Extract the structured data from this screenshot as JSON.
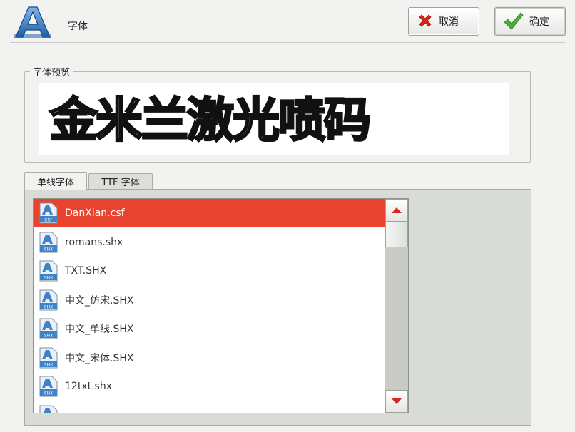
{
  "header": {
    "title": "字体",
    "cancel_label": "取消",
    "ok_label": "确定",
    "logo_icon": "font-letter-a-icon"
  },
  "preview": {
    "legend": "字体预览",
    "sample_text": "金米兰激光喷码"
  },
  "tabs": [
    {
      "label": "单线字体",
      "active": true
    },
    {
      "label": "TTF 字体",
      "active": false
    }
  ],
  "font_list": {
    "items": [
      {
        "name": "DanXian.csf",
        "badge": "CSF",
        "selected": true
      },
      {
        "name": "romans.shx",
        "badge": "SHX",
        "selected": false
      },
      {
        "name": "TXT.SHX",
        "badge": "SHX",
        "selected": false
      },
      {
        "name": "中文_仿宋.SHX",
        "badge": "SHX",
        "selected": false
      },
      {
        "name": "中文_单线.SHX",
        "badge": "SHX",
        "selected": false
      },
      {
        "name": "中文_宋体.SHX",
        "badge": "SHX",
        "selected": false
      },
      {
        "name": "12txt.shx",
        "badge": "SHX",
        "selected": false
      },
      {
        "name": "",
        "badge": "SHX",
        "selected": false
      }
    ]
  },
  "colors": {
    "selection": "#e8432f",
    "cancel_icon": "#d9261c",
    "ok_icon": "#4cae3a",
    "scroll_arrow": "#d9261c",
    "file_icon": "#3f83c6"
  }
}
